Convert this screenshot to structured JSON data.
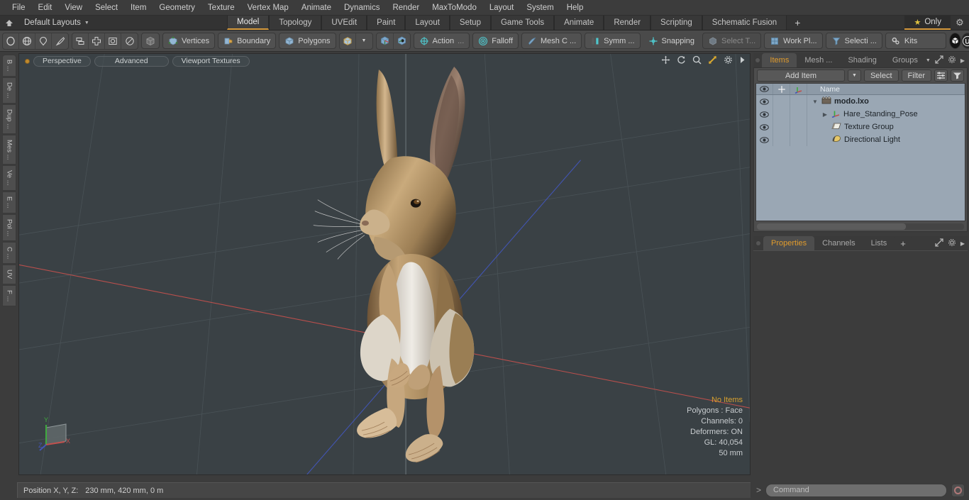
{
  "menubar": {
    "items": [
      "File",
      "Edit",
      "View",
      "Select",
      "Item",
      "Geometry",
      "Texture",
      "Vertex Map",
      "Animate",
      "Dynamics",
      "Render",
      "MaxToModo",
      "Layout",
      "System",
      "Help"
    ]
  },
  "layoutbar": {
    "home_icon": "home-icon",
    "layout_select": "Default Layouts",
    "caret": "▼",
    "tabs": [
      {
        "label": "Model",
        "active": true
      },
      {
        "label": "Topology",
        "active": false
      },
      {
        "label": "UVEdit",
        "active": false
      },
      {
        "label": "Paint",
        "active": false
      },
      {
        "label": "Layout",
        "active": false
      },
      {
        "label": "Setup",
        "active": false
      },
      {
        "label": "Game Tools",
        "active": false
      },
      {
        "label": "Animate",
        "active": false
      },
      {
        "label": "Render",
        "active": false
      },
      {
        "label": "Scripting",
        "active": false
      },
      {
        "label": "Schematic Fusion",
        "active": false
      }
    ],
    "add_tab_label": "+",
    "only_label": "Only",
    "star_glyph": "★",
    "gear_glyph": "⚙",
    "accent_color": "#d79a3c"
  },
  "toolbar": {
    "selection_modes": [
      "circle-select-icon",
      "globe-select-icon",
      "lasso-select-icon",
      "paint-select-icon"
    ],
    "component_modes": [
      "element-move-icon",
      "element-add-icon",
      "element-box-icon",
      "element-circle-icon"
    ],
    "mesh_icon": "mesh-cube-icon",
    "vertices_label": "Vertices",
    "boundary_label": "Boundary",
    "polygons_label": "Polygons",
    "item_cube_icon": "item-cube-icon",
    "dropdown_caret": "▼",
    "snap_icon_1": "snap-pivot-icon",
    "snap_icon_2": "snap-center-icon",
    "action_label": "Action",
    "action_ellipsis": "...",
    "falloff_label": "Falloff",
    "mesh_constraint_label": "Mesh C ...",
    "symmetry_label": "Symm ...",
    "snapping_label": "Snapping",
    "select_through_label": "Select T...",
    "work_plane_label": "Work Pl...",
    "selection_set_label": "Selecti ...",
    "kits_label": "Kits",
    "round_icon_1": "modo-box-icon",
    "round_icon_2": "unreal-engine-icon"
  },
  "left_tabs": [
    "B ...",
    "De ...",
    "Dup ...",
    "Mes ...",
    "Ve ...",
    "E ...",
    "Pol ...",
    "C ...",
    "UV",
    "F ..."
  ],
  "viewport": {
    "dot": "viewport-active-dot",
    "perspective_label": "Perspective",
    "advanced_label": "Advanced",
    "textures_label": "Viewport Textures",
    "tools": [
      "pan-icon",
      "rotate-icon",
      "zoom-icon",
      "fit-icon",
      "gear-icon",
      "arrow-icon"
    ],
    "stats": [
      {
        "text": "No Items",
        "highlight": true
      },
      {
        "text": "Polygons : Face",
        "highlight": false
      },
      {
        "text": "Channels: 0",
        "highlight": false
      },
      {
        "text": "Deformers: ON",
        "highlight": false
      },
      {
        "text": "GL: 40,054",
        "highlight": false
      },
      {
        "text": "50 mm",
        "highlight": false
      }
    ],
    "gizmo_axes": [
      "Y",
      "X",
      "Z"
    ],
    "background_color": "#3a4145",
    "x_axis_color": "#c85a5a",
    "z_axis_color": "#4a5fc8",
    "y_axis_color": "#4fae4f"
  },
  "right_panel": {
    "tabs": [
      {
        "label": "Items",
        "active": true
      },
      {
        "label": "Mesh ...",
        "active": false
      },
      {
        "label": "Shading",
        "active": false
      },
      {
        "label": "Groups",
        "active": false
      }
    ],
    "tab_tools": [
      "caret-down-icon",
      "expand-icon",
      "gear-icon",
      "arrow-right-icon"
    ],
    "item_toolbar": {
      "add_item_label": "Add Item",
      "add_item_caret": "▼",
      "select_label": "Select",
      "filter_label": "Filter",
      "list_icon": "list-config-icon",
      "funnel_icon": "funnel-icon"
    },
    "list_headers": {
      "eye": "visibility-icon",
      "lock": "lock-move-icon",
      "axis": "axis-icon",
      "name": "Name"
    },
    "items": [
      {
        "name": "modo.lxo",
        "icon": "scene-clapper-icon",
        "depth": 0,
        "twisty": "▼",
        "root": true
      },
      {
        "name": "Hare_Standing_Pose",
        "icon": "mesh-axis-icon",
        "depth": 1,
        "twisty": "▶",
        "root": false
      },
      {
        "name": "Texture Group",
        "icon": "texture-group-icon",
        "depth": 1,
        "twisty": "",
        "root": false
      },
      {
        "name": "Directional Light",
        "icon": "directional-light-icon",
        "depth": 1,
        "twisty": "",
        "root": false
      }
    ]
  },
  "properties_panel": {
    "tabs": [
      {
        "label": "Properties",
        "active": true
      },
      {
        "label": "Channels",
        "active": false
      },
      {
        "label": "Lists",
        "active": false
      }
    ],
    "add_tab_label": "+",
    "tools": [
      "expand-icon",
      "gear-icon",
      "arrow-right-icon"
    ]
  },
  "statusbar": {
    "position_label": "Position X, Y, Z:",
    "position_value": "230 mm, 420 mm, 0 m"
  },
  "command_bar": {
    "prompt": ">",
    "placeholder": "Command",
    "value": "",
    "record_icon": "record-icon"
  }
}
